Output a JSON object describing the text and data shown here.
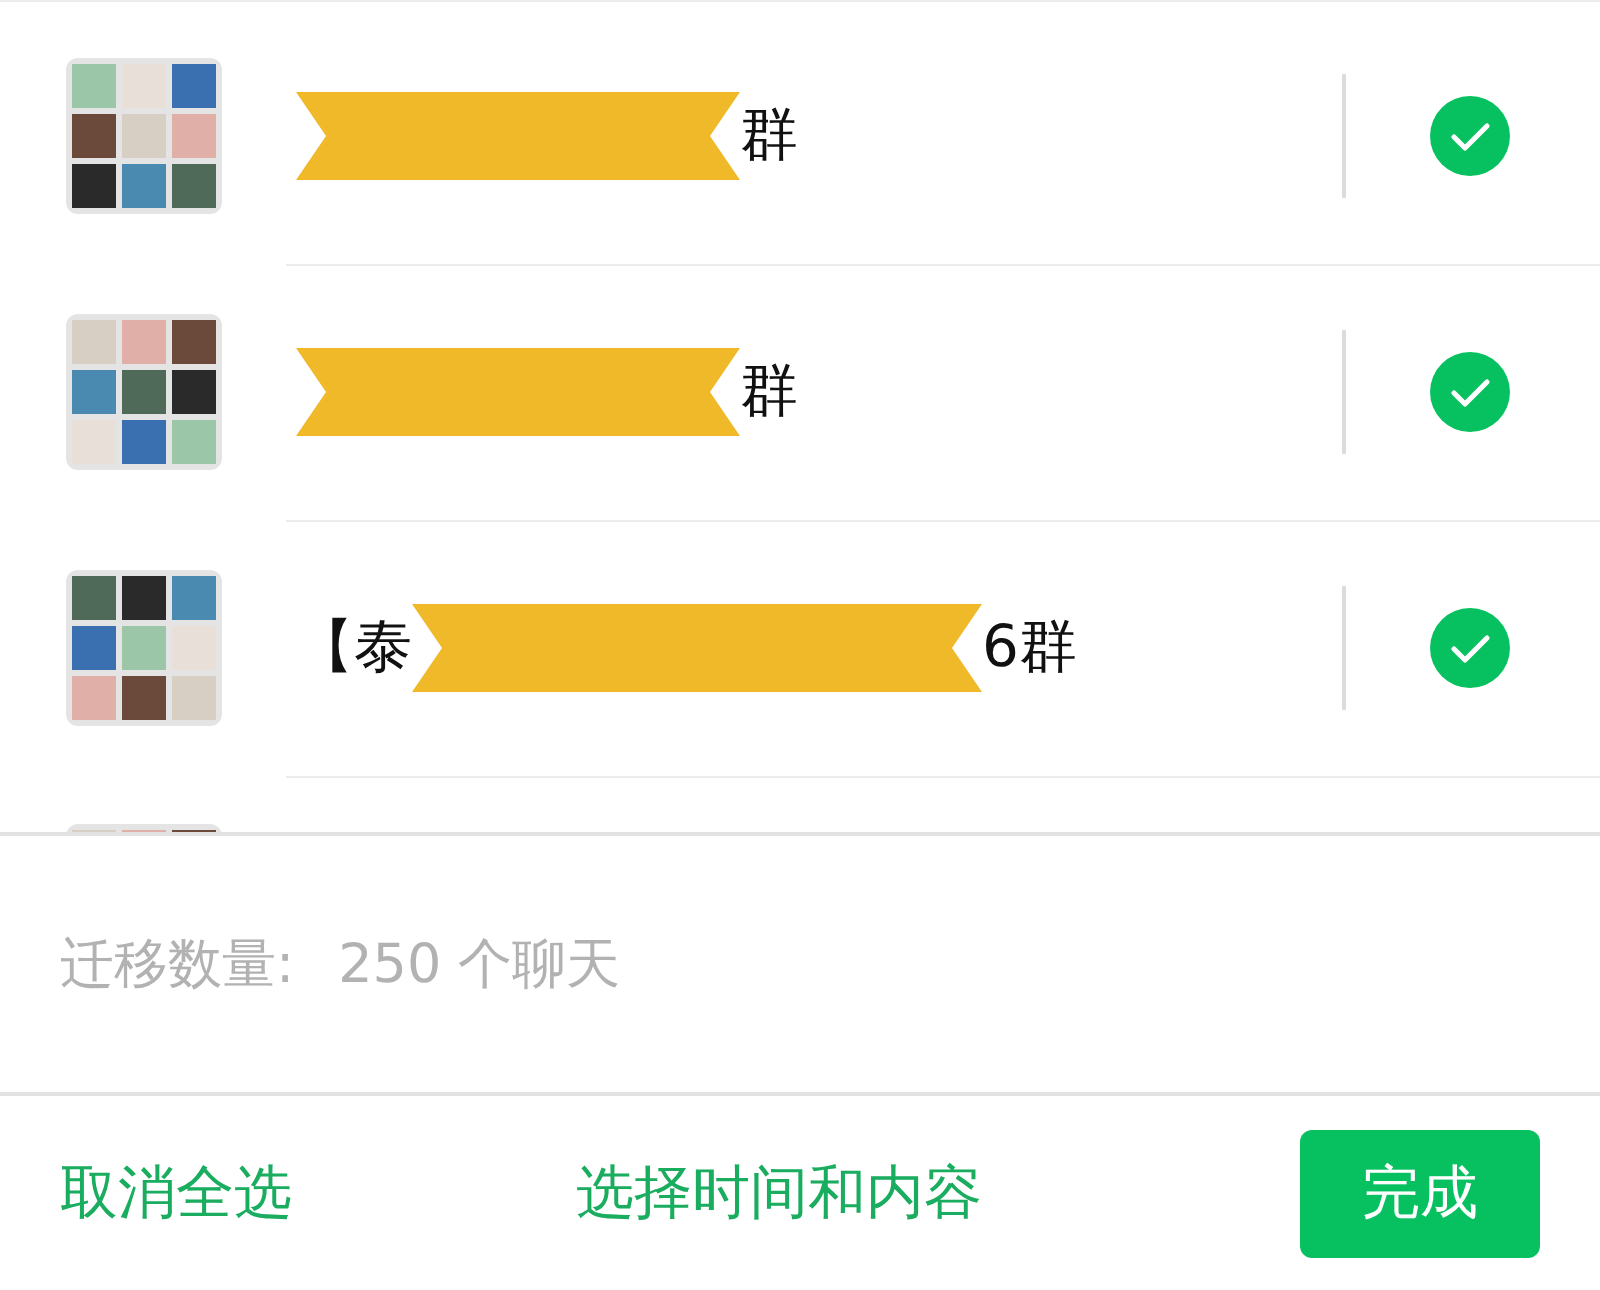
{
  "chats": [
    {
      "name_end": "群",
      "redacted": true,
      "checked": true
    },
    {
      "name_end": "群",
      "redacted": true,
      "checked": true
    },
    {
      "name_start": "【泰",
      "name_end": "6群",
      "redacted": true,
      "checked": true
    }
  ],
  "summary": {
    "label": "迁移数量:",
    "value": "250 个聊天"
  },
  "footer": {
    "deselect_all": "取消全选",
    "choose_time": "选择时间和内容",
    "done": "完成"
  }
}
